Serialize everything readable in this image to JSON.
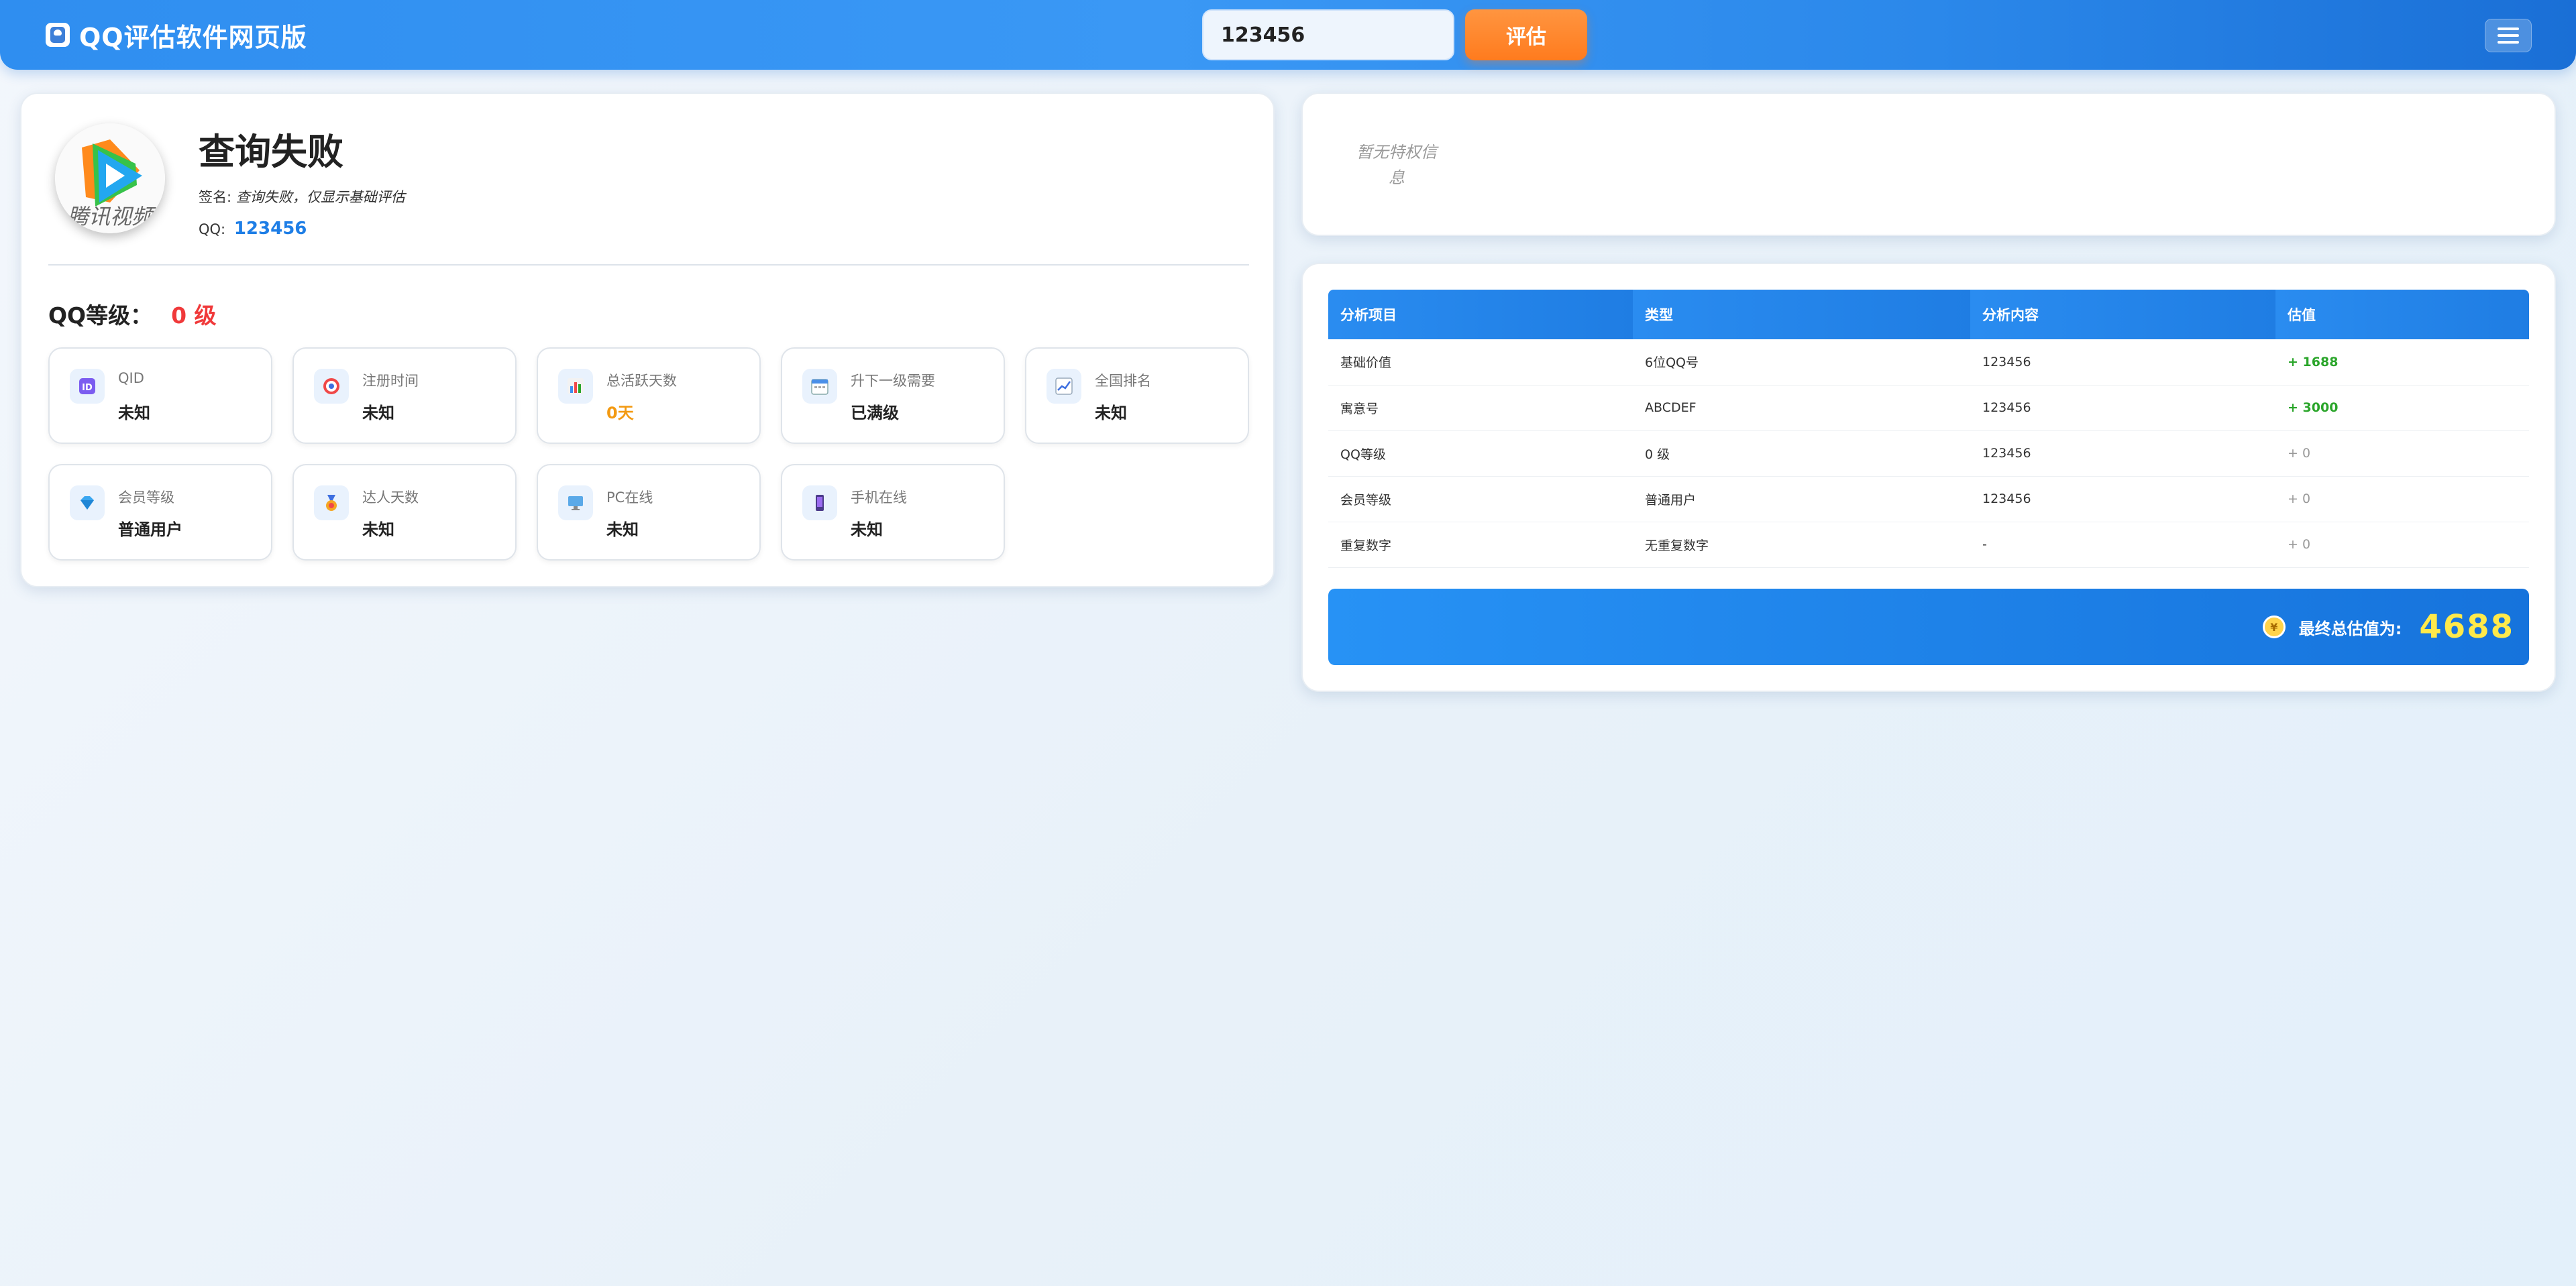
{
  "header": {
    "title": "QQ评估软件网页版",
    "logo_icon": "qq-penguin-icon",
    "search_value": "123456",
    "evaluate_label": "评估",
    "menu_icon": "hamburger-menu-icon"
  },
  "profile": {
    "avatar_text": "腾讯视频",
    "name": "查询失败",
    "signature_label": "签名:",
    "signature": "查询失败，仅显示基础评估",
    "qq_label": "QQ:",
    "qq_number": "123456",
    "level_label": "QQ等级：",
    "level_value": "0 级",
    "tiles": [
      {
        "label": "QID",
        "value": "未知",
        "icon": "id-icon"
      },
      {
        "label": "注册时间",
        "value": "未知",
        "icon": "target-icon"
      },
      {
        "label": "总活跃天数",
        "value": "0天",
        "icon": "bar-chart-icon"
      },
      {
        "label": "升下一级需要",
        "value": "已满级",
        "icon": "calendar-icon"
      },
      {
        "label": "全国排名",
        "value": "未知",
        "icon": "trend-chart-icon"
      },
      {
        "label": "会员等级",
        "value": "普通用户",
        "icon": "diamond-icon"
      },
      {
        "label": "达人天数",
        "value": "未知",
        "icon": "medal-icon"
      },
      {
        "label": "PC在线",
        "value": "未知",
        "icon": "desktop-icon"
      },
      {
        "label": "手机在线",
        "value": "未知",
        "icon": "phone-icon"
      }
    ]
  },
  "privilege": {
    "empty_text": "暂无特权信息"
  },
  "analysis": {
    "headers": [
      "分析项目",
      "类型",
      "分析内容",
      "估值"
    ],
    "rows": [
      [
        "基础价值",
        "6位QQ号",
        "123456",
        "+ 1688"
      ],
      [
        "寓意号",
        "ABCDEF",
        "123456",
        "+ 3000"
      ],
      [
        "QQ等级",
        "0 级",
        "123456",
        "+ 0"
      ],
      [
        "会员等级",
        "普通用户",
        "123456",
        "+ 0"
      ],
      [
        "重复数字",
        "无重复数字",
        "-",
        "+ 0"
      ]
    ],
    "total_label": "最终总估值为:",
    "total_value": "4688",
    "total_icon": "coin-icon"
  },
  "colors": {
    "brand_blue": "#2f8ef0",
    "evaluate_orange": "#ff7b1e",
    "level_red": "#f0393a",
    "positive_green": "#2aa52a",
    "total_yellow": "#ffe94a"
  }
}
